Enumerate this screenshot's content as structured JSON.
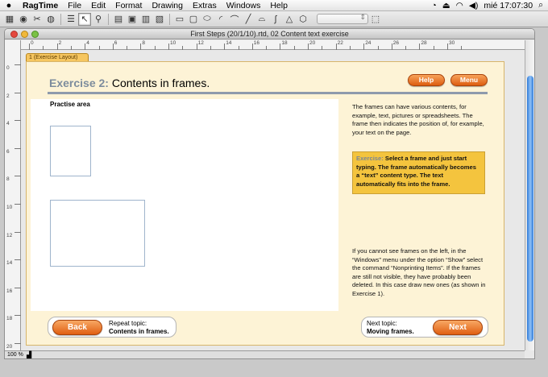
{
  "menubar": {
    "apple_icon": "apple-icon",
    "app_name": "RagTime",
    "items": [
      "File",
      "Edit",
      "Format",
      "Drawing",
      "Extras",
      "Windows",
      "Help"
    ],
    "clock": "mié 17:07:30"
  },
  "window": {
    "title": "First Steps (20/1/10).rtd, 02 Content text exercise",
    "layout_tab": "1 (Exercise Layout)",
    "zoom": "100 %",
    "ruler_numbers": [
      "0",
      "2",
      "4",
      "6",
      "8",
      "10",
      "12",
      "14",
      "16",
      "18",
      "20",
      "22",
      "24",
      "26",
      "28",
      "30"
    ]
  },
  "exercise": {
    "number_label": "Exercise 2:",
    "title": "Contents in frames.",
    "help_button": "Help",
    "menu_button": "Menu"
  },
  "practise_area": {
    "label": "Practise area"
  },
  "texts": {
    "intro": "The frames can have various contents, for example, text, pictures or spreadsheets. The frame then indicates the position of, for example, your text on the page.",
    "hint_label": "Exercise:",
    "hint_body": "Select a frame and just start typing. The frame automatically becomes a “text” content type. The text automatically fits into the frame.",
    "note": "If you cannot see frames on the left, in the “Windows” menu under the option “Show” select the command “Nonprinting Items”. If the frames are still not visible, they have probably been deleted. In this case draw new ones (as shown in Exercise 1)."
  },
  "navigation": {
    "back_button": "Back",
    "repeat_label": "Repeat topic:",
    "repeat_topic": "Contents in frames.",
    "next_label": "Next topic:",
    "next_topic": "Moving frames.",
    "next_button": "Next"
  },
  "colors": {
    "page_background": "#fdf3d6",
    "accent_orange": "#e5691b",
    "hint_yellow": "#f4c43e",
    "scroll_blue": "#2f7bd9"
  }
}
